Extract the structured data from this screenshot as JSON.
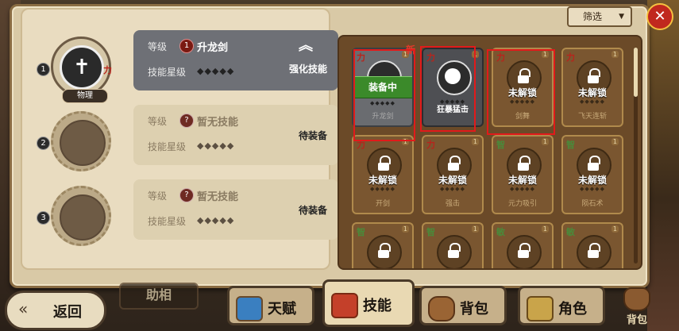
{
  "filter_label": "筛选",
  "slots": [
    {
      "index": "1",
      "level_label": "等级",
      "level_badge": "1",
      "skill_name": "升龙剑",
      "stars_label": "技能星级",
      "stars": "◆◆◆◆◆",
      "action": "强化技能",
      "attr_tag": "力",
      "type_label": "物理",
      "active": true
    },
    {
      "index": "2",
      "level_label": "等级",
      "level_badge": "?",
      "skill_name": "暂无技能",
      "stars_label": "技能星级",
      "stars": "◆◆◆◆◆",
      "action": "待装备",
      "active": false
    },
    {
      "index": "3",
      "level_label": "等级",
      "level_badge": "?",
      "skill_name": "暂无技能",
      "stars_label": "技能星级",
      "stars": "◆◆◆◆◆",
      "action": "待装备",
      "active": false
    }
  ],
  "cards": [
    {
      "attr": "力",
      "count": "1",
      "name": "升龙剑",
      "state": "equipped",
      "banner": "装备中",
      "new": "新",
      "stars": "◆◆◆◆◆"
    },
    {
      "attr": "力",
      "count": "1",
      "name": "狂暴猛击",
      "state": "unlocked",
      "stars": "◆◆◆◆◆"
    },
    {
      "attr": "力",
      "count": "1",
      "name": "剑舞",
      "state": "locked",
      "lock_text": "未解锁",
      "stars": "◆◆◆◆◆"
    },
    {
      "attr": "力",
      "count": "1",
      "name": "飞天连斩",
      "state": "locked",
      "lock_text": "未解锁",
      "stars": "◆◆◆◆◆"
    },
    {
      "attr": "力",
      "count": "1",
      "name": "开剑",
      "state": "locked",
      "lock_text": "未解锁",
      "stars": "◆◆◆◆◆"
    },
    {
      "attr": "力",
      "count": "1",
      "name": "强击",
      "state": "locked",
      "lock_text": "未解锁",
      "stars": "◆◆◆◆◆"
    },
    {
      "attr": "智",
      "count": "1",
      "name": "元力吸引",
      "state": "locked",
      "lock_text": "未解锁",
      "stars": "◆◆◆◆◆"
    },
    {
      "attr": "智",
      "count": "1",
      "name": "陨石术",
      "state": "locked",
      "lock_text": "未解锁",
      "stars": "◆◆◆◆◆"
    },
    {
      "attr": "智",
      "count": "1",
      "name": "",
      "state": "locked-partial"
    },
    {
      "attr": "智",
      "count": "1",
      "name": "",
      "state": "locked-partial"
    },
    {
      "attr": "敏",
      "count": "1",
      "name": "",
      "state": "locked-partial"
    },
    {
      "attr": "敏",
      "count": "1",
      "name": "",
      "state": "locked-partial"
    }
  ],
  "nav": {
    "back": "返回",
    "under_label": "助相",
    "tabs": [
      "天赋",
      "技能",
      "背包",
      "角色"
    ],
    "corner": "背包"
  }
}
